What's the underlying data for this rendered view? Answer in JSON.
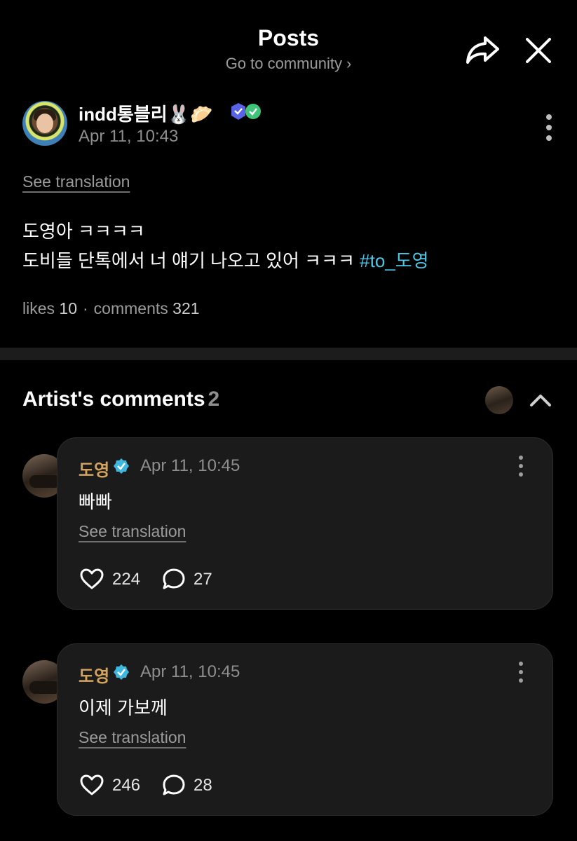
{
  "header": {
    "title": "Posts",
    "community_link": "Go to community",
    "chevron": "›"
  },
  "post": {
    "author": "indd통블리",
    "author_emoji": "🐰🥟",
    "timestamp": "Apr 11, 10:43",
    "see_translation": "See translation",
    "line1": "도영아 ㅋㅋㅋㅋ",
    "line2": "도비들 단톡에서 너 얘기 나오고 있어 ㅋㅋㅋ ",
    "hashtag": "#to_도영",
    "likes_label": "likes",
    "likes_count": "10",
    "separator": "·",
    "comments_label": "comments",
    "comments_count": "321"
  },
  "artist_comments": {
    "title": "Artist's comments",
    "count": "2",
    "items": [
      {
        "author": "도영",
        "timestamp": "Apr 11, 10:45",
        "text": "빠빠",
        "see_translation": "See translation",
        "likes": "224",
        "replies": "27"
      },
      {
        "author": "도영",
        "timestamp": "Apr 11, 10:45",
        "text": "이제 가보께",
        "see_translation": "See translation",
        "likes": "246",
        "replies": "28"
      }
    ]
  },
  "colors": {
    "background": "#000000",
    "accent_hashtag": "#4fc7e6",
    "artist_name": "#d4a35d",
    "card": "#1b1b1b"
  },
  "icons": [
    "share-icon",
    "close-icon",
    "more-vertical-icon",
    "verified-icon",
    "heart-icon",
    "comment-icon",
    "chevron-up-icon"
  ]
}
